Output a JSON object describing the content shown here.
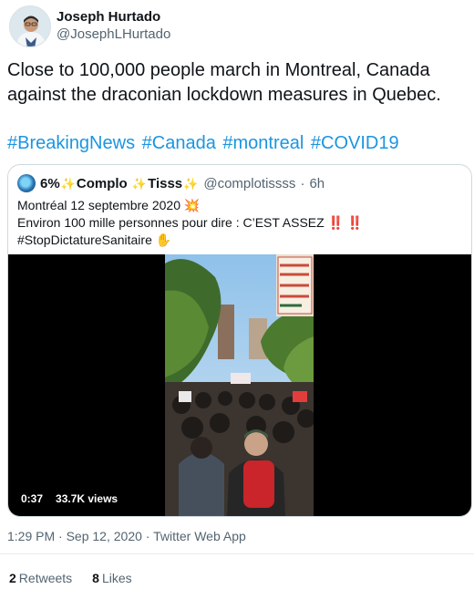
{
  "author": {
    "name": "Joseph Hurtado",
    "handle": "@JosephLHurtado"
  },
  "tweet": {
    "text": "Close to 100,000 people march in Montreal, Canada against the draconian lockdown measures in Quebec.",
    "hashtags": [
      "#BreakingNews",
      "#Canada",
      "#montreal",
      "#COVID19"
    ]
  },
  "quoted_tweet": {
    "name_part1": "6%",
    "name_part2": "Complo",
    "name_part3": "Tisss",
    "sparkle": "✨",
    "handle": "@complotissss",
    "separator": "·",
    "time": "6h",
    "line1": "Montréal 12 septembre 2020",
    "line1_emoji": "💥",
    "line2": "Environ 100 mille personnes pour dire : C’EST ASSEZ",
    "line2_emoji": "‼️ ‼️",
    "line3": "#StopDictatureSanitaire",
    "line3_emoji": "✋",
    "video": {
      "duration": "0:37",
      "views": "33.7K views"
    }
  },
  "meta": {
    "time": "1:29 PM",
    "separator": "·",
    "date": "Sep 12, 2020",
    "source": "Twitter Web App"
  },
  "stats": {
    "retweets_count": "2",
    "retweets_label": "Retweets",
    "likes_count": "8",
    "likes_label": "Likes"
  },
  "colors": {
    "hashtag": "#1b95e0",
    "secondary_text": "#536471",
    "border": "#cfd9de"
  }
}
